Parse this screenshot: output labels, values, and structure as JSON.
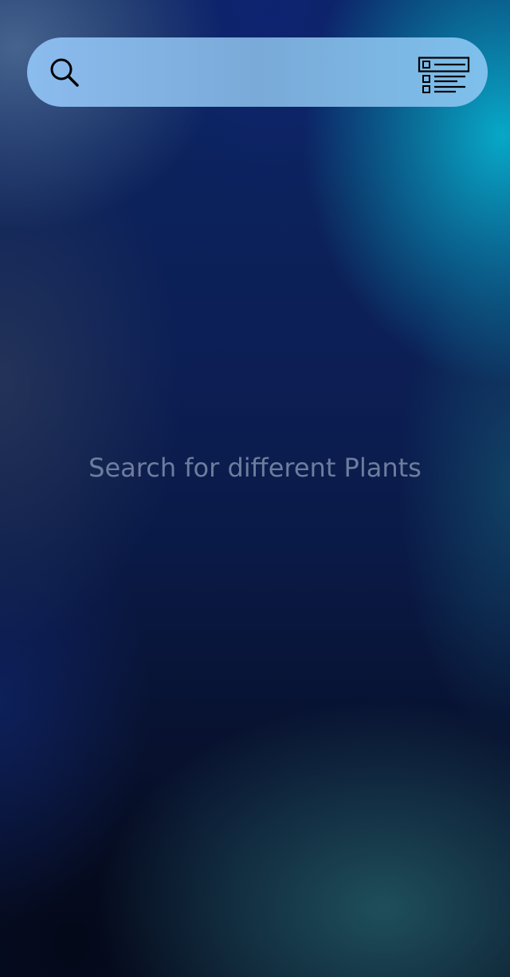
{
  "search": {
    "value": "",
    "placeholder": "",
    "icon": "search-icon"
  },
  "filter": {
    "icon": "list-filter-icon"
  },
  "empty_state": {
    "message": "Search for different Plants"
  },
  "colors": {
    "search_bar": "#8bbcee",
    "icon_stroke": "#000000",
    "message_text": "#6d7d9d",
    "background_dark": "#0a1a48",
    "background_accent": "#08afcd"
  }
}
